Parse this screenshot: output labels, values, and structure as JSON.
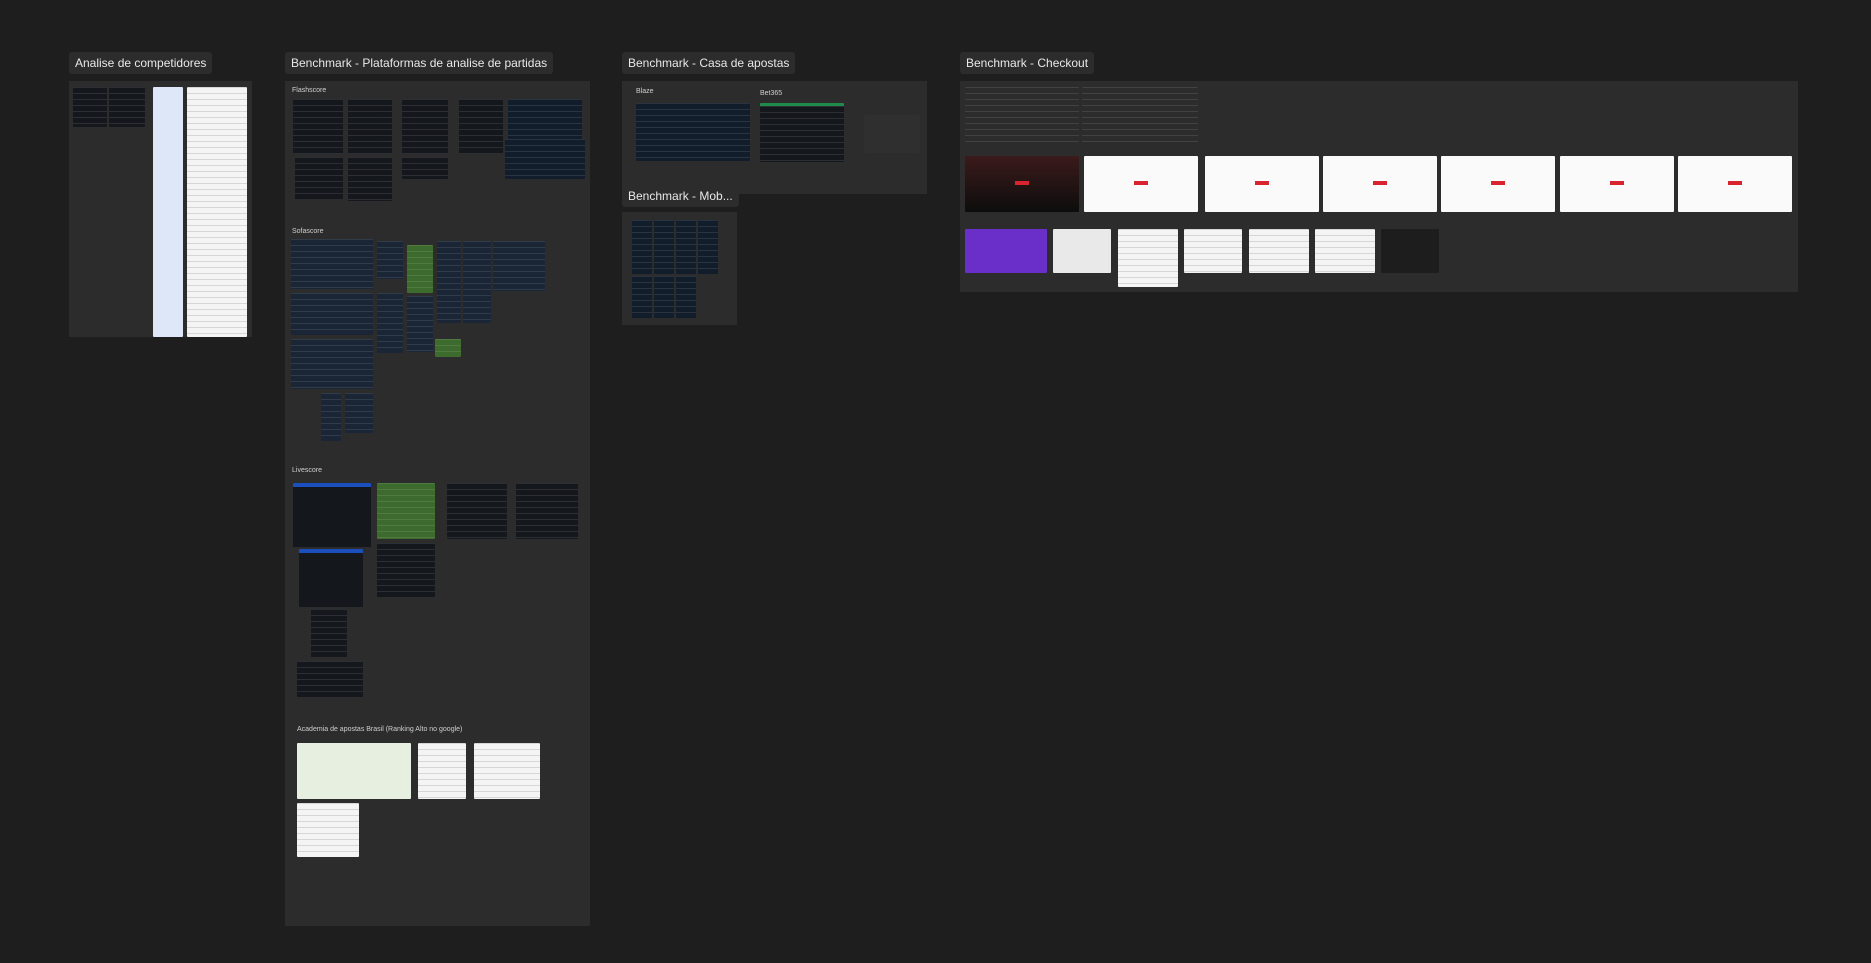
{
  "canvas": {
    "frames": [
      {
        "id": "analise",
        "label": "Analise de competidores"
      },
      {
        "id": "plataformas",
        "label": "Benchmark - Plataformas de analise de partidas"
      },
      {
        "id": "casa",
        "label": "Benchmark - Casa de apostas"
      },
      {
        "id": "mobile",
        "label": "Benchmark - Mob..."
      },
      {
        "id": "checkout",
        "label": "Benchmark - Checkout"
      }
    ],
    "sections": {
      "flashscore": "Flashscore",
      "sofascore": "Sofascore",
      "livescore": "Livescore",
      "academia": "Academia de apostas Brasil (Ranking Alto no google)",
      "blaze": "Blaze",
      "bet365": "Bet365"
    }
  },
  "colors": {
    "canvas_bg": "#1e1e1e",
    "frame_bg": "#2c2c2c",
    "label_bg": "#2c2c2c",
    "accent_red": "#d9232e",
    "accent_purple": "#6b2fc9"
  }
}
